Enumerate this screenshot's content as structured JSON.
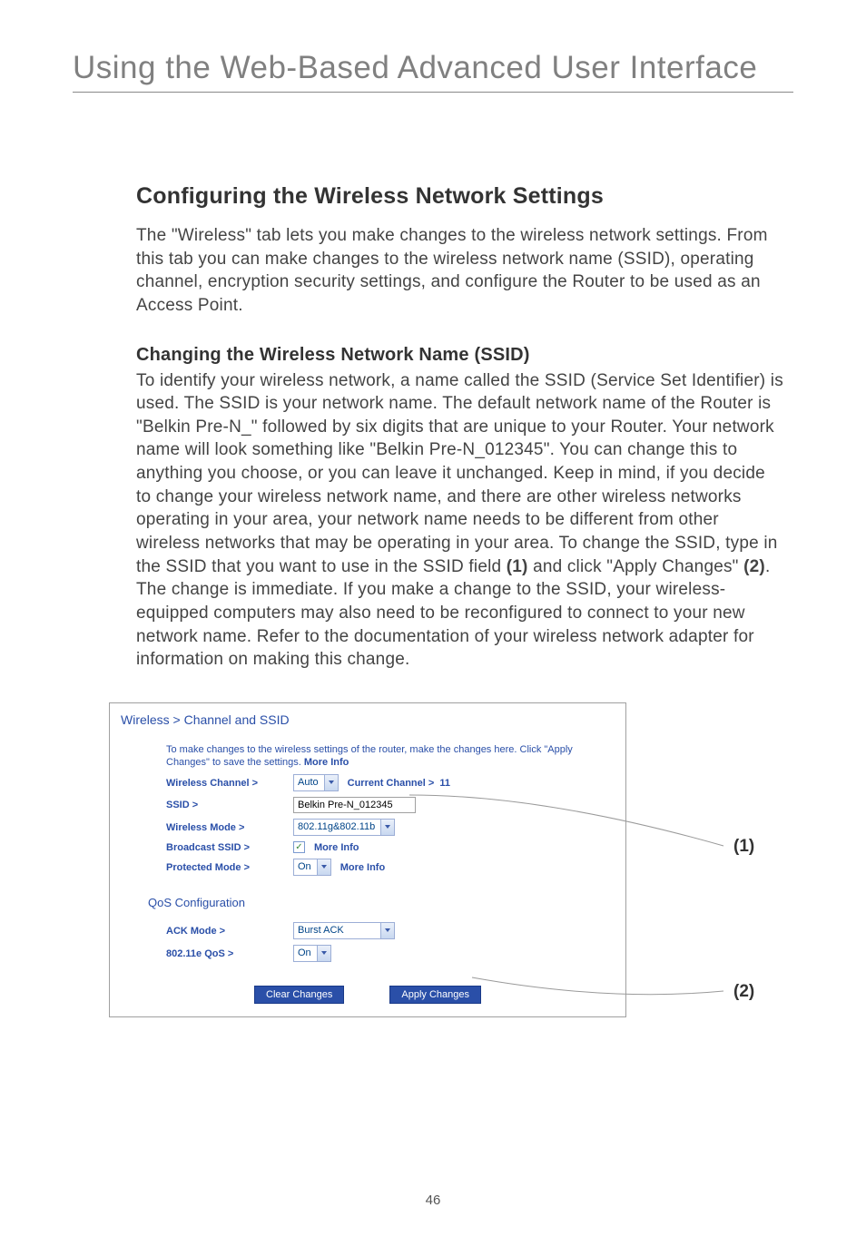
{
  "mainTitle": "Using the Web-Based Advanced User Interface",
  "sectionHeading": "Configuring the Wireless Network Settings",
  "introPara": "The \"Wireless\" tab lets you make changes to the wireless network settings. From this tab you can make changes to the wireless network name (SSID), operating channel, encryption security settings, and configure the Router to be used as an Access Point.",
  "subHeading": "Changing the Wireless Network Name (SSID)",
  "bodyTextA": "To identify your wireless network, a name called the SSID (Service Set Identifier) is used. The SSID is your network name. The default network name of the Router is \"Belkin Pre-N_\" followed by six digits that are unique to your Router. Your network name will look something like \"Belkin Pre-N_012345\". You can change this to anything you choose, or you can leave it unchanged. Keep in mind, if you decide to change your wireless network name, and there are other wireless networks operating in your area, your network name needs to be different from other wireless networks that may be operating in your area. To change the SSID, type in the SSID that you want to use in the SSID field ",
  "ref1": "(1)",
  "bodyTextB": " and click \"Apply Changes\" ",
  "ref2": "(2)",
  "bodyTextC": ". The change is immediate. If you make a change to the SSID, your wireless-equipped computers may also need to be reconfigured to connect to your new network name. Refer to the documentation of your wireless network adapter for information on making this change.",
  "screenshot": {
    "breadcrumb": "Wireless > Channel and SSID",
    "descA": "To make changes to the wireless settings of the router, make the changes here. Click \"Apply Changes\" to save the settings. ",
    "moreInfo": "More Info",
    "rows": {
      "wirelessChannel": {
        "label": "Wireless Channel >",
        "value": "Auto",
        "currentLabel": "Current Channel >",
        "currentValue": "11"
      },
      "ssid": {
        "label": "SSID >",
        "value": "Belkin Pre-N_012345"
      },
      "wirelessMode": {
        "label": "Wireless Mode >",
        "value": "802.11g&802.11b"
      },
      "broadcast": {
        "label": "Broadcast SSID >",
        "checked": "✓"
      },
      "protected": {
        "label": "Protected Mode >",
        "value": "On"
      }
    },
    "qosTitle": "QoS Configuration",
    "qos": {
      "ack": {
        "label": "ACK Mode >",
        "value": "Burst ACK"
      },
      "qos": {
        "label": "802.11e QoS >",
        "value": "On"
      }
    },
    "buttons": {
      "clear": "Clear Changes",
      "apply": "Apply Changes"
    }
  },
  "callouts": {
    "c1": "(1)",
    "c2": "(2)"
  },
  "pageNumber": "46"
}
